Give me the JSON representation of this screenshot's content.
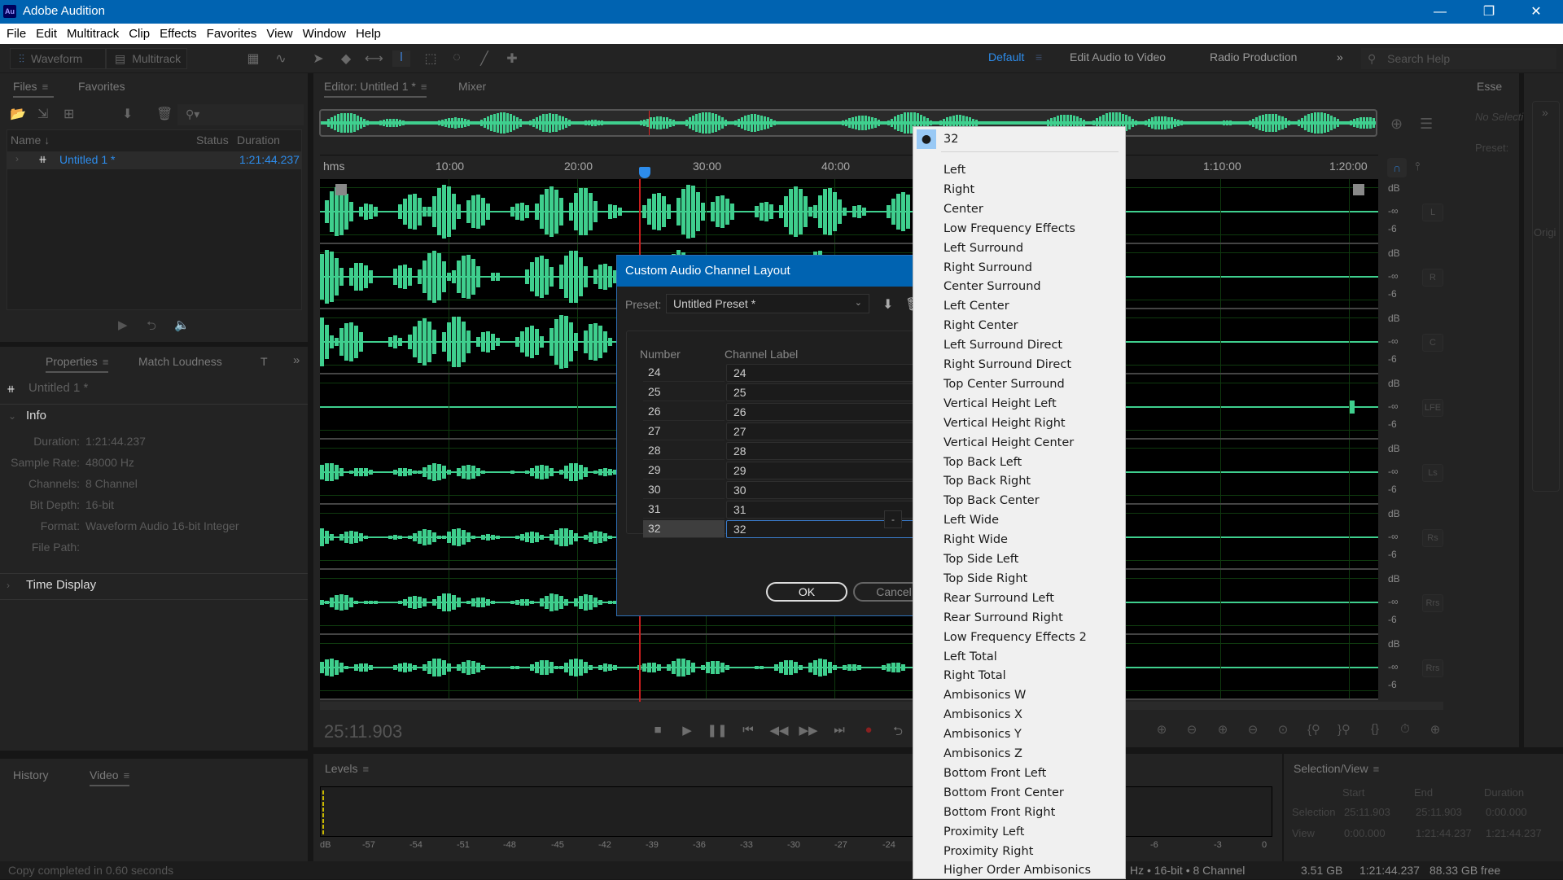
{
  "app": {
    "title": "Adobe Audition",
    "logo": "Au"
  },
  "window_controls": {
    "minimize": "—",
    "maximize": "❐",
    "close": "✕"
  },
  "menu": [
    "File",
    "Edit",
    "Multitrack",
    "Clip",
    "Effects",
    "Favorites",
    "View",
    "Window",
    "Help"
  ],
  "toolbar": {
    "waveform_label": "Waveform",
    "multitrack_label": "Multitrack",
    "workspaces": [
      "Default",
      "Edit Audio to Video",
      "Radio Production"
    ],
    "active_workspace": "Default",
    "search_placeholder": "Search Help"
  },
  "files_panel": {
    "tabs": [
      "Files",
      "Favorites"
    ],
    "columns": [
      "Name",
      "Status",
      "Duration"
    ],
    "files": [
      {
        "name": "Untitled 1 *",
        "duration": "1:21:44.237"
      }
    ]
  },
  "properties_panel": {
    "tabs": [
      "Properties",
      "Match Loudness",
      "T"
    ],
    "file_name": "Untitled 1 *",
    "info_heading": "Info",
    "info": [
      {
        "label": "Duration:",
        "value": "1:21:44.237"
      },
      {
        "label": "Sample Rate:",
        "value": "48000 Hz"
      },
      {
        "label": "Channels:",
        "value": "8 Channel"
      },
      {
        "label": "Bit Depth:",
        "value": "16-bit"
      },
      {
        "label": "Format:",
        "value": "Waveform Audio 16-bit Integer"
      },
      {
        "label": "File Path:",
        "value": ""
      }
    ],
    "time_display": "Time Display"
  },
  "history_panel": {
    "tabs": [
      "History",
      "Video"
    ]
  },
  "editor": {
    "tabs": [
      "Editor: Untitled 1 *",
      "Mixer"
    ],
    "ruler": [
      "hms",
      "10:00",
      "20:00",
      "30:00",
      "40:00",
      "1:10:00",
      "1:20:00"
    ],
    "channels": [
      {
        "label": "L",
        "db": "dB",
        "inf": "-∞",
        "minus6": "-6"
      },
      {
        "label": "R",
        "db": "dB",
        "inf": "-∞",
        "minus6": "-6"
      },
      {
        "label": "C",
        "db": "dB",
        "inf": "-∞",
        "minus6": "-6"
      },
      {
        "label": "LFE",
        "db": "dB",
        "inf": "-∞",
        "minus6": "-6"
      },
      {
        "label": "Ls",
        "db": "dB",
        "inf": "-∞",
        "minus6": "-6"
      },
      {
        "label": "Rs",
        "db": "dB",
        "inf": "-∞",
        "minus6": "-6"
      },
      {
        "label": "Rrs",
        "db": "dB",
        "inf": "-∞",
        "minus6": "-6"
      },
      {
        "label": "Rrs",
        "db": "dB",
        "inf": "-∞",
        "minus6": "-6"
      }
    ],
    "current_time": "25:11.903"
  },
  "levels": {
    "title": "Levels",
    "scale": [
      "dB",
      "-57",
      "-54",
      "-51",
      "-48",
      "-45",
      "-42",
      "-39",
      "-36",
      "-33",
      "-30",
      "-27",
      "-24",
      "-6",
      "-3",
      "0"
    ]
  },
  "selection_view": {
    "title": "Selection/View",
    "columns": [
      "Start",
      "End",
      "Duration"
    ],
    "rows": [
      {
        "label": "Selection",
        "start": "25:11.903",
        "end": "25:11.903",
        "duration": "0:00.000"
      },
      {
        "label": "View",
        "start": "0:00.000",
        "end": "1:21:44.237",
        "duration": "1:21:44.237"
      }
    ]
  },
  "essential_sound": {
    "tab": "Esse",
    "no_selection": "No Selecti",
    "preset": "Preset:",
    "orig": "Origi"
  },
  "status_bar": {
    "message": "Copy completed in 0.60 seconds",
    "format": "Hz • 16-bit • 8 Channel",
    "size": "3.51 GB",
    "duration": "1:21:44.237",
    "free": "88.33 GB free"
  },
  "dialog": {
    "title": "Custom Audio Channel Layout",
    "preset_label": "Preset:",
    "preset_value": "Untitled Preset *",
    "columns": [
      "Number",
      "Channel Label"
    ],
    "rows": [
      {
        "num": "24",
        "label": "24"
      },
      {
        "num": "25",
        "label": "25"
      },
      {
        "num": "26",
        "label": "26"
      },
      {
        "num": "27",
        "label": "27"
      },
      {
        "num": "28",
        "label": "28"
      },
      {
        "num": "29",
        "label": "29"
      },
      {
        "num": "30",
        "label": "30"
      },
      {
        "num": "31",
        "label": "31"
      },
      {
        "num": "32",
        "label": "32"
      }
    ],
    "selected_row": "32",
    "remove_label": "-",
    "ok": "OK",
    "cancel": "Cancel"
  },
  "dropdown": {
    "selected": "32",
    "options": [
      "Left",
      "Right",
      "Center",
      "Low Frequency Effects",
      "Left Surround",
      "Right Surround",
      "Center Surround",
      "Left Center",
      "Right Center",
      "Left Surround Direct",
      "Right Surround Direct",
      "Top Center Surround",
      "Vertical Height Left",
      "Vertical Height Right",
      "Vertical Height Center",
      "Top Back Left",
      "Top Back Right",
      "Top Back Center",
      "Left Wide",
      "Right Wide",
      "Top Side Left",
      "Top Side Right",
      "Rear Surround Left",
      "Rear Surround Right",
      "Low Frequency Effects 2",
      "Left Total",
      "Right Total",
      "Ambisonics W",
      "Ambisonics X",
      "Ambisonics Y",
      "Ambisonics Z",
      "Bottom Front Left",
      "Bottom Front Center",
      "Bottom Front Right",
      "Proximity Left",
      "Proximity Right",
      "Higher Order Ambisonics"
    ]
  },
  "colors": {
    "accent": "#2d8ceb",
    "waveform": "#4ee8a8",
    "titlebar": "#0063b1",
    "playhead": "#e02020"
  }
}
